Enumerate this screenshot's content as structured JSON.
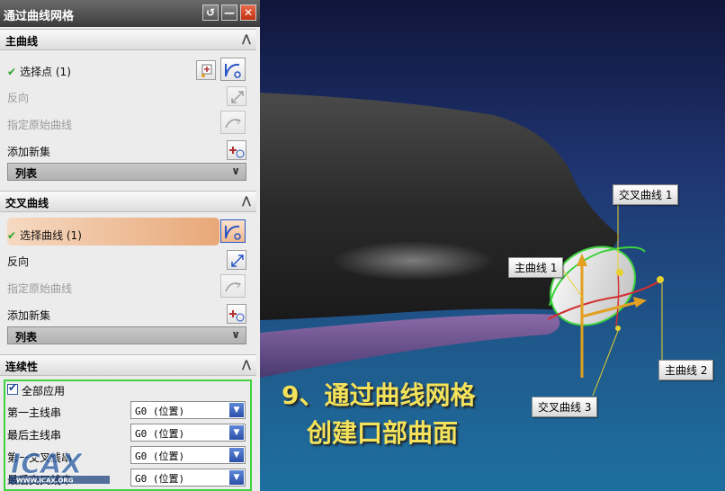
{
  "dialog": {
    "title": "通过曲线网格",
    "title_buttons": {
      "reset": "↺",
      "minimize": "—",
      "close": "✕"
    },
    "primary_curves": {
      "header": "主曲线",
      "select_points": "选择点 (1)",
      "reverse": "反向",
      "specify_original_curve": "指定原始曲线",
      "add_new_set": "添加新集",
      "list": "列表"
    },
    "cross_curves": {
      "header": "交叉曲线",
      "select_curves": "选择曲线 (1)",
      "reverse": "反向",
      "specify_original_curve": "指定原始曲线",
      "add_new_set": "添加新集",
      "list": "列表"
    },
    "continuity": {
      "header": "连续性",
      "apply_all": "全部应用",
      "apply_all_checked": true,
      "rows": [
        {
          "label": "第一主线串",
          "value": "G0 (位置)"
        },
        {
          "label": "最后主线串",
          "value": "G0 (位置)"
        },
        {
          "label": "第一交叉线串",
          "value": "G0 (位置)"
        },
        {
          "label": "最后交叉线串",
          "value": "G0 (位置)"
        }
      ]
    },
    "logo_text": "ICAX",
    "logo_url": "WWW.ICAX.ORG"
  },
  "viewport": {
    "callouts": {
      "cross_curve_1": "交叉曲线 1",
      "primary_curve_1": "主曲线 1",
      "primary_curve_2": "主曲线 2",
      "cross_curve_3": "交叉曲线 3"
    },
    "caption_line1": "9、通过曲线网格",
    "caption_line2": "创建口部曲面"
  }
}
